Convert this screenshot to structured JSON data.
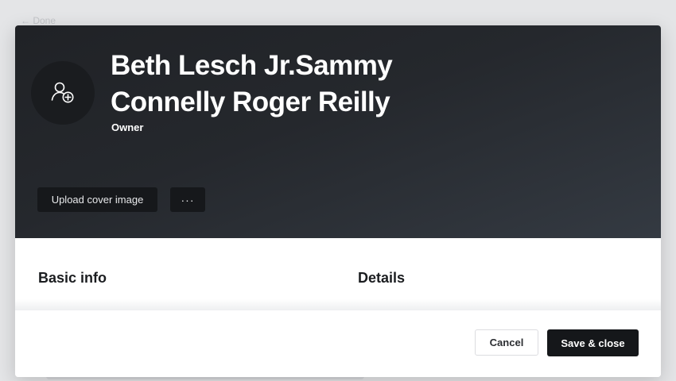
{
  "background": {
    "back_link": "← Done"
  },
  "profile": {
    "name": "Beth Lesch Jr.Sammy Connelly Roger Reilly",
    "role": "Owner",
    "avatar_icon": "add-user-icon"
  },
  "cover_actions": {
    "upload_label": "Upload cover image",
    "more_label": "···"
  },
  "sections": {
    "basic_info": "Basic info",
    "details": "Details"
  },
  "footer": {
    "cancel_label": "Cancel",
    "save_label": "Save & close"
  },
  "colors": {
    "cover_dark": "#202226",
    "cover_light": "#343a42",
    "primary_button": "#15171a",
    "page_background": "#e4e5e7"
  }
}
